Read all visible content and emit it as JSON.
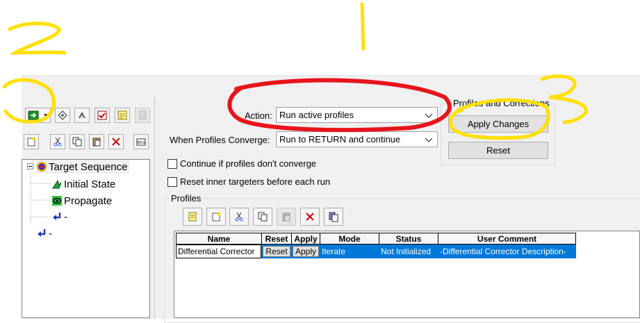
{
  "toolbar": {
    "run_icon": "run-arrow-icon",
    "dropdown_icon": "chevron-down-icon"
  },
  "tree": {
    "items": [
      {
        "label": "Target Sequence"
      },
      {
        "label": "Initial State"
      },
      {
        "label": "Propagate"
      },
      {
        "label": "-"
      },
      {
        "label": "-"
      }
    ]
  },
  "action": {
    "label": "Action:",
    "value": "Run active profiles"
  },
  "converge": {
    "label": "When Profiles Converge:",
    "value": "Run to RETURN and continue"
  },
  "options": {
    "continue_label": "Continue if profiles don't converge",
    "reset_inner_label": "Reset inner targeters before each run"
  },
  "profiles_corrections": {
    "title": "Profiles and Corrections",
    "apply_label": "Apply Changes",
    "reset_label": "Reset"
  },
  "profiles": {
    "title": "Profiles",
    "columns": [
      "Name",
      "Reset",
      "Apply",
      "Mode",
      "Status",
      "User Comment"
    ],
    "rows": [
      {
        "name": "Differential Corrector",
        "reset": "Reset",
        "apply": "Apply",
        "mode": "Iterate",
        "status": "Not Initialized",
        "comment": "-Differential Corrector Description-"
      }
    ]
  },
  "annotations": [
    "2",
    "1",
    "3"
  ],
  "colors": {
    "annotation_yellow": "#ffe000",
    "annotation_red": "#e8141c",
    "selection_blue": "#0078d7"
  }
}
